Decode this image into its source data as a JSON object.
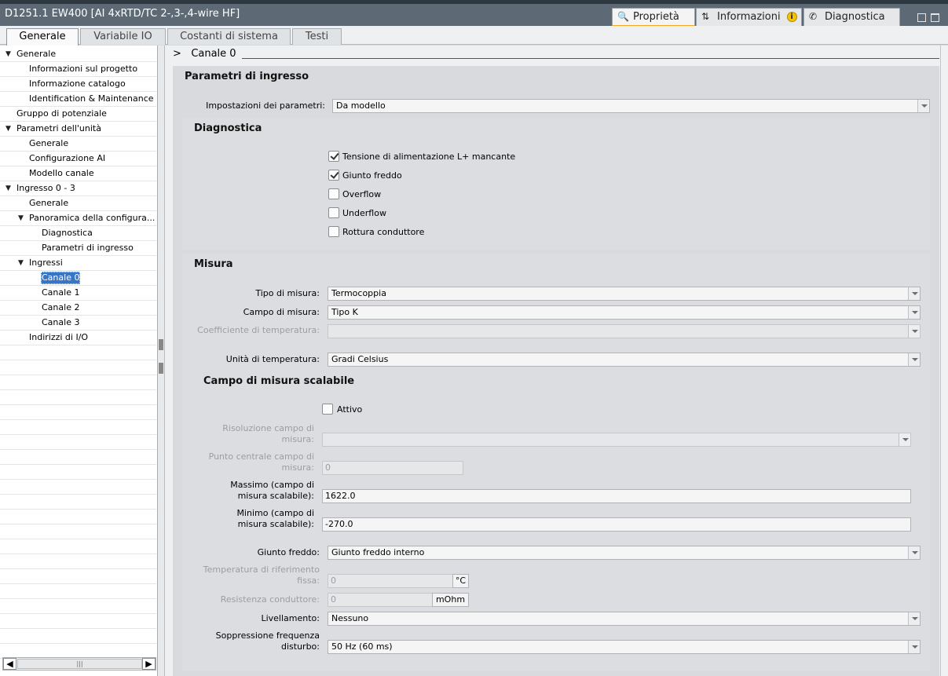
{
  "window": {
    "title": "D1251.1 EW400 [AI 4xRTD/TC 2-,3-,4-wire HF]",
    "panel_tabs": [
      {
        "label": "Proprietà",
        "icon": "properties-icon"
      },
      {
        "label": "Informazioni",
        "icon": "info-icon"
      },
      {
        "label": "Diagnostica",
        "icon": "diagnostics-icon"
      }
    ],
    "info_badge": "i"
  },
  "main_tabs": [
    "Generale",
    "Variabile IO",
    "Costanti di sistema",
    "Testi"
  ],
  "tree": [
    {
      "label": "Generale",
      "level": 0,
      "expanded": true
    },
    {
      "label": "Informazioni sul progetto",
      "level": 1
    },
    {
      "label": "Informazione catalogo",
      "level": 1
    },
    {
      "label": "Identification & Maintenance",
      "level": 1
    },
    {
      "label": "Gruppo di potenziale",
      "level": 0
    },
    {
      "label": "Parametri dell'unità",
      "level": 0,
      "expanded": true
    },
    {
      "label": "Generale",
      "level": 1
    },
    {
      "label": "Configurazione AI",
      "level": 1
    },
    {
      "label": "Modello canale",
      "level": 1
    },
    {
      "label": "Ingresso 0 - 3",
      "level": 0,
      "expanded": true
    },
    {
      "label": "Generale",
      "level": 1
    },
    {
      "label": "Panoramica della configura...",
      "level": 1,
      "expanded": true
    },
    {
      "label": "Diagnostica",
      "level": 2
    },
    {
      "label": "Parametri di ingresso",
      "level": 2
    },
    {
      "label": "Ingressi",
      "level": 1,
      "expanded": true
    },
    {
      "label": "Canale 0",
      "level": 2,
      "selected": true
    },
    {
      "label": "Canale 1",
      "level": 2
    },
    {
      "label": "Canale 2",
      "level": 2
    },
    {
      "label": "Canale 3",
      "level": 2
    },
    {
      "label": "Indirizzi di I/O",
      "level": 1
    }
  ],
  "content": {
    "breadcrumb_arrow": ">",
    "breadcrumb": "Canale 0",
    "input_params": {
      "title": "Parametri di ingresso",
      "param_settings_label": "Impostazioni dei parametri:",
      "param_settings_value": "Da modello"
    },
    "diagnostics": {
      "title": "Diagnostica",
      "options": [
        {
          "label": "Tensione di alimentazione L+ mancante",
          "checked": true
        },
        {
          "label": "Giunto freddo",
          "checked": true
        },
        {
          "label": "Overflow",
          "checked": false
        },
        {
          "label": "Underflow",
          "checked": false
        },
        {
          "label": "Rottura conduttore",
          "checked": false
        }
      ]
    },
    "measure": {
      "title": "Misura",
      "type_label": "Tipo di misura:",
      "type_value": "Termocoppia",
      "range_label": "Campo di misura:",
      "range_value": "Tipo K",
      "temp_coeff_label": "Coefficiente di temperatura:",
      "temp_coeff_value": "",
      "temp_unit_label": "Unità di temperatura:",
      "temp_unit_value": "Gradi Celsius",
      "scalable_title": "Campo di misura scalabile",
      "active_label": "Attivo",
      "active_checked": false,
      "resolution_label_1": "Risoluzione campo di",
      "resolution_label_2": "misura:",
      "resolution_value": "",
      "center_label_1": "Punto centrale campo di",
      "center_label_2": "misura:",
      "center_value": "0",
      "max_label_1": "Massimo (campo di",
      "max_label_2": "misura scalabile):",
      "max_value": "1622.0",
      "min_label_1": "Minimo (campo di",
      "min_label_2": "misura scalabile):",
      "min_value": "-270.0",
      "cold_junction_label": "Giunto freddo:",
      "cold_junction_value": "Giunto freddo interno",
      "ref_temp_label_1": "Temperatura di riferimento",
      "ref_temp_label_2": "fissa:",
      "ref_temp_value": "0",
      "ref_temp_unit": "°C",
      "wire_res_label": "Resistenza conduttore:",
      "wire_res_value": "0",
      "wire_res_unit": "mOhm",
      "smoothing_label": "Livellamento:",
      "smoothing_value": "Nessuno",
      "interference_label_1": "Soppressione frequenza",
      "interference_label_2": "disturbo:",
      "interference_value": "50 Hz (60 ms)"
    }
  }
}
